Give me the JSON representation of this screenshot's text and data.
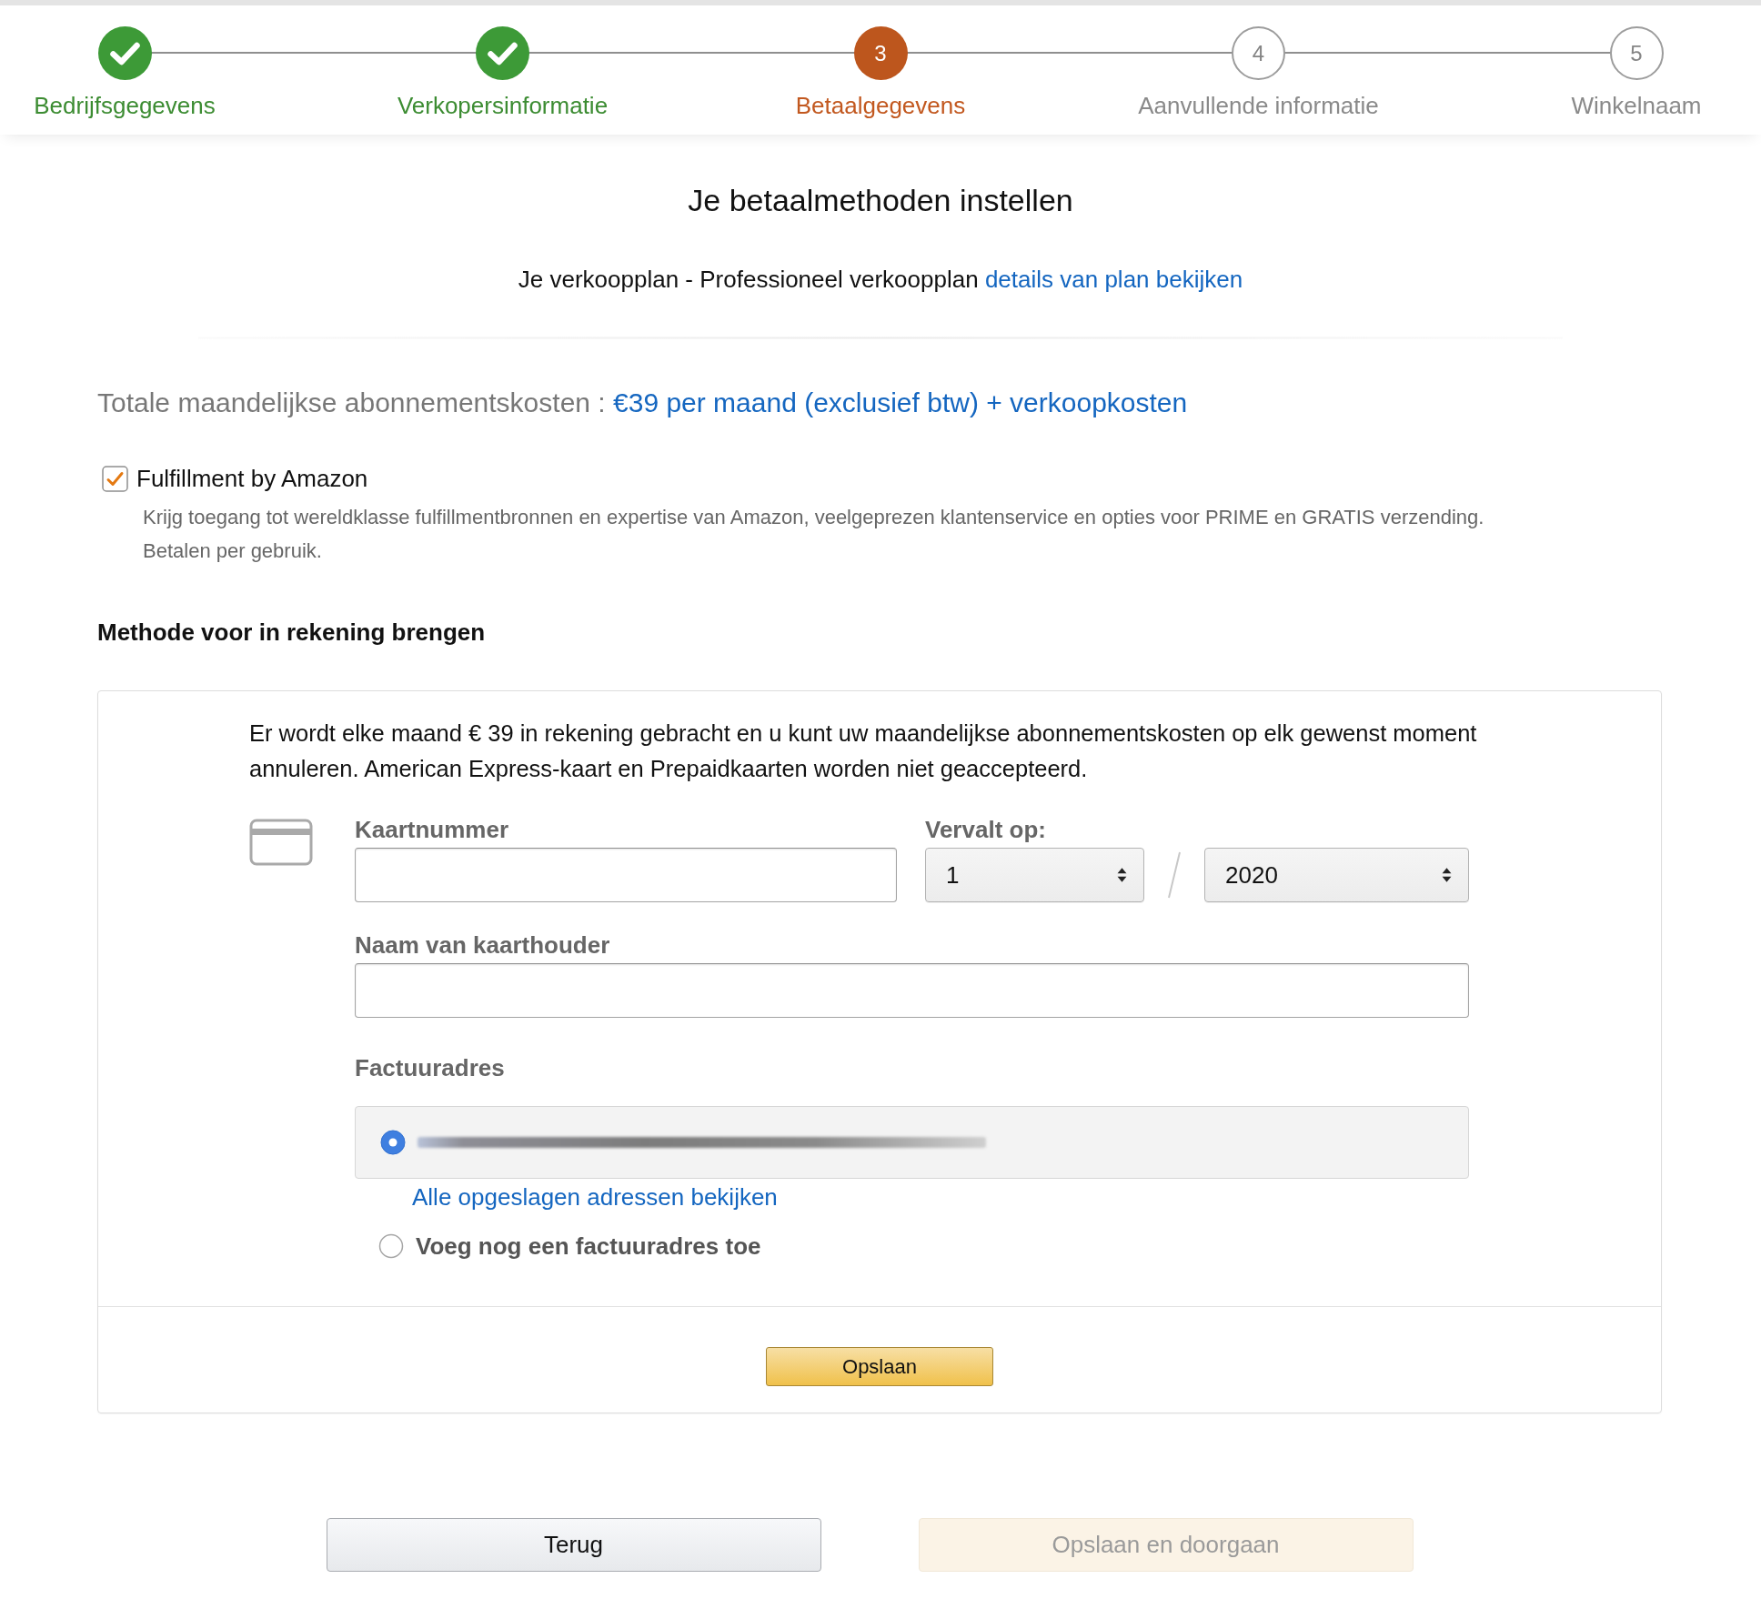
{
  "steps": [
    {
      "label": "Bedrijfsgegevens",
      "completed": true,
      "selected": false
    },
    {
      "label": "Verkopersinformatie",
      "completed": true,
      "selected": false
    },
    {
      "number": "3",
      "label": "Betaalgegevens",
      "completed": false,
      "selected": true
    },
    {
      "number": "4",
      "label": "Aanvullende informatie",
      "completed": false,
      "selected": false
    },
    {
      "number": "5",
      "label": "Winkelnaam",
      "completed": false,
      "selected": false
    }
  ],
  "page_title": "Je betaalmethoden instellen",
  "plan": {
    "text": "Je verkoopplan - Professioneel verkoopplan",
    "link": "details van plan bekijken"
  },
  "subscription": {
    "label": "Totale maandelijkse abonnementskosten :",
    "value": "€39 per maand (exclusief btw) + verkoopkosten"
  },
  "fba": {
    "label": "Fulfillment by Amazon",
    "checked": true,
    "description": [
      "Krijg toegang tot wereldklasse fulfillmentbronnen en expertise van Amazon, veelgeprezen klantenservice en opties voor PRIME en GRATIS verzending.",
      "Betalen per gebruik."
    ]
  },
  "billing": {
    "title": "Methode voor in rekening brengen",
    "notice": "Er wordt elke maand € 39 in rekening gebracht en u kunt uw maandelijkse abonnementskosten op elk gewenst moment annuleren. American Express-kaart en Prepaidkaarten worden niet geaccepteerd.",
    "card_number": {
      "label": "Kaartnummer"
    },
    "expiry": {
      "label": "Vervalt op:",
      "month": "1",
      "year": "2020"
    },
    "cardholder": {
      "label": "Naam van kaarthouder"
    },
    "address": {
      "label": "Factuuradres",
      "options": [
        {
          "kind": "saved",
          "selected": true
        },
        {
          "kind": "new",
          "label": "Voeg nog een factuuradres toe",
          "selected": false
        }
      ],
      "link": "Alle opgeslagen adressen bekijken"
    },
    "save_button": "Opslaan"
  },
  "footer_buttons": [
    {
      "label": "Terug",
      "disabled": false
    },
    {
      "label": "Opslaan en doorgaan",
      "disabled": true
    }
  ]
}
